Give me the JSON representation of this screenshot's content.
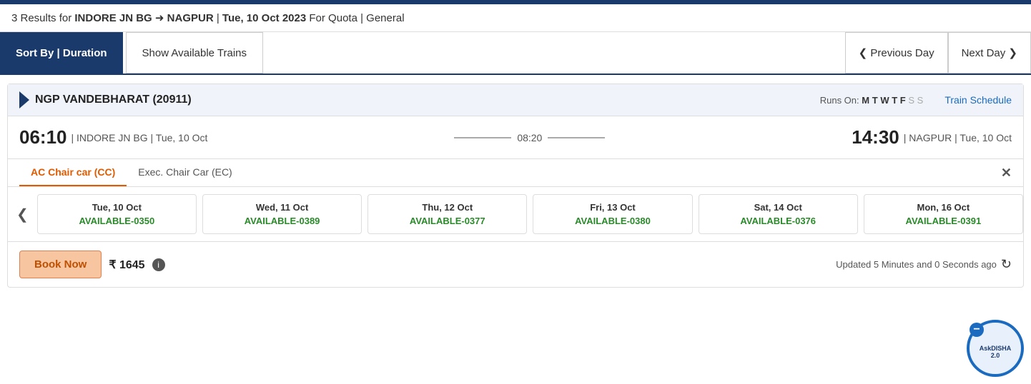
{
  "topbar": {
    "results_text": "3 Results for",
    "route_from": "INDORE JN BG",
    "arrow": "➜",
    "route_to": "NAGPUR",
    "separator": "|",
    "date": "Tue, 10 Oct 2023",
    "for_quota": "For Quota",
    "quota": "|",
    "quota_type": "General"
  },
  "toolbar": {
    "sort_label": "Sort By | Duration",
    "show_label": "Show Available Trains",
    "prev_label": "❮ Previous Day",
    "next_label": "Next Day ❯"
  },
  "train": {
    "name": "NGP VANDEBHARAT (20911)",
    "runs_on_label": "Runs On:",
    "days": [
      {
        "day": "M",
        "active": true
      },
      {
        "day": "T",
        "active": true
      },
      {
        "day": "W",
        "active": true
      },
      {
        "day": "T",
        "active": true
      },
      {
        "day": "F",
        "active": true
      },
      {
        "day": "S",
        "active": false
      },
      {
        "day": "S",
        "active": false
      }
    ],
    "schedule_link": "Train Schedule",
    "depart_time": "06:10",
    "depart_sep": "|",
    "depart_station": "INDORE JN BG",
    "depart_date": "Tue, 10 Oct",
    "duration": "08:20",
    "arrive_time": "14:30",
    "arrive_sep": "|",
    "arrive_station": "NAGPUR",
    "arrive_date": "Tue, 10 Oct",
    "tabs": [
      {
        "label": "AC Chair car (CC)",
        "active": true
      },
      {
        "label": "Exec. Chair Car (EC)",
        "active": false
      }
    ],
    "close_symbol": "✕",
    "availability": [
      {
        "date": "Tue, 10 Oct",
        "status": "AVAILABLE-0350"
      },
      {
        "date": "Wed, 11 Oct",
        "status": "AVAILABLE-0389"
      },
      {
        "date": "Thu, 12 Oct",
        "status": "AVAILABLE-0377"
      },
      {
        "date": "Fri, 13 Oct",
        "status": "AVAILABLE-0380"
      },
      {
        "date": "Sat, 14 Oct",
        "status": "AVAILABLE-0376"
      },
      {
        "date": "Mon, 16 Oct",
        "status": "AVAILABLE-0391"
      }
    ],
    "book_btn": "Book Now",
    "currency": "₹",
    "price": "1645",
    "updated_text": "Updated 5 Minutes and 0 Seconds ago",
    "refresh_symbol": "↻"
  }
}
